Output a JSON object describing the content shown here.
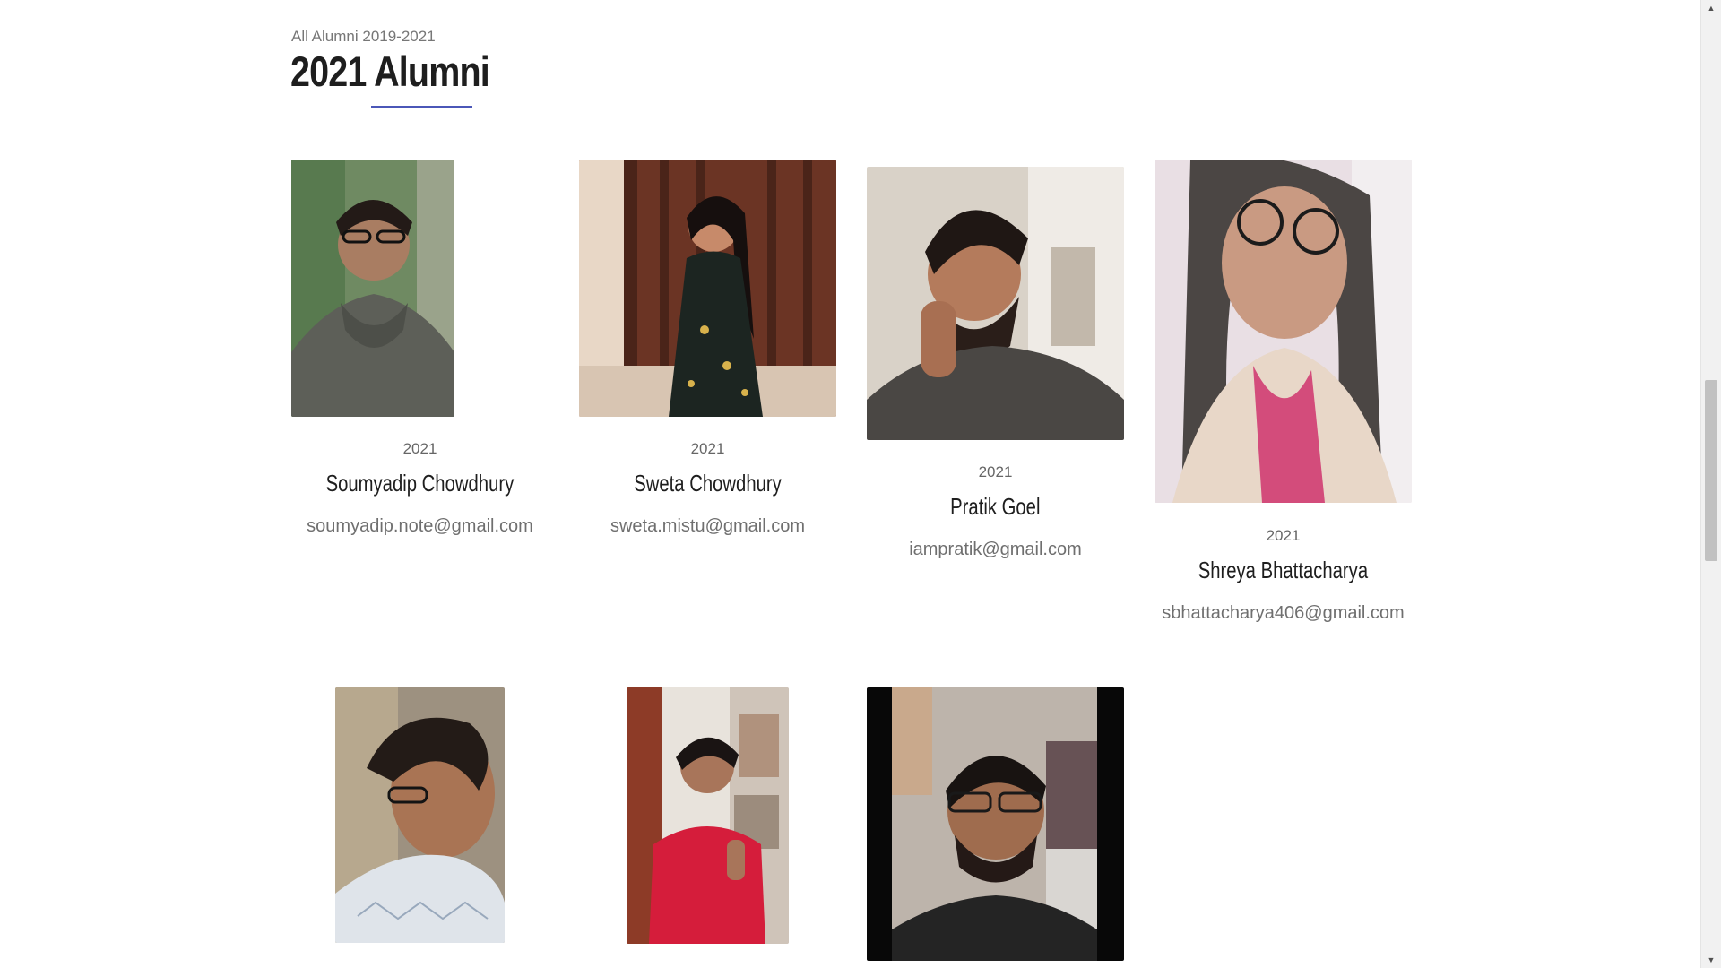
{
  "section": {
    "breadcrumb": "All Alumni 2019-2021",
    "title": "2021 Alumni"
  },
  "colors": {
    "accent": "#4b57b8",
    "name_text": "#1e1e1e",
    "email_text": "#6f6f6f"
  },
  "alumni": [
    {
      "year": "2021",
      "name": "Soumyadip Chowdhury",
      "email": "soumyadip.note@gmail.com"
    },
    {
      "year": "2021",
      "name": "Sweta Chowdhury",
      "email": "sweta.mistu@gmail.com"
    },
    {
      "year": "2021",
      "name": "Pratik Goel",
      "email": "iampratik@gmail.com"
    },
    {
      "year": "2021",
      "name": "Shreya Bhattacharya",
      "email": "sbhattacharya406@gmail.com"
    }
  ]
}
